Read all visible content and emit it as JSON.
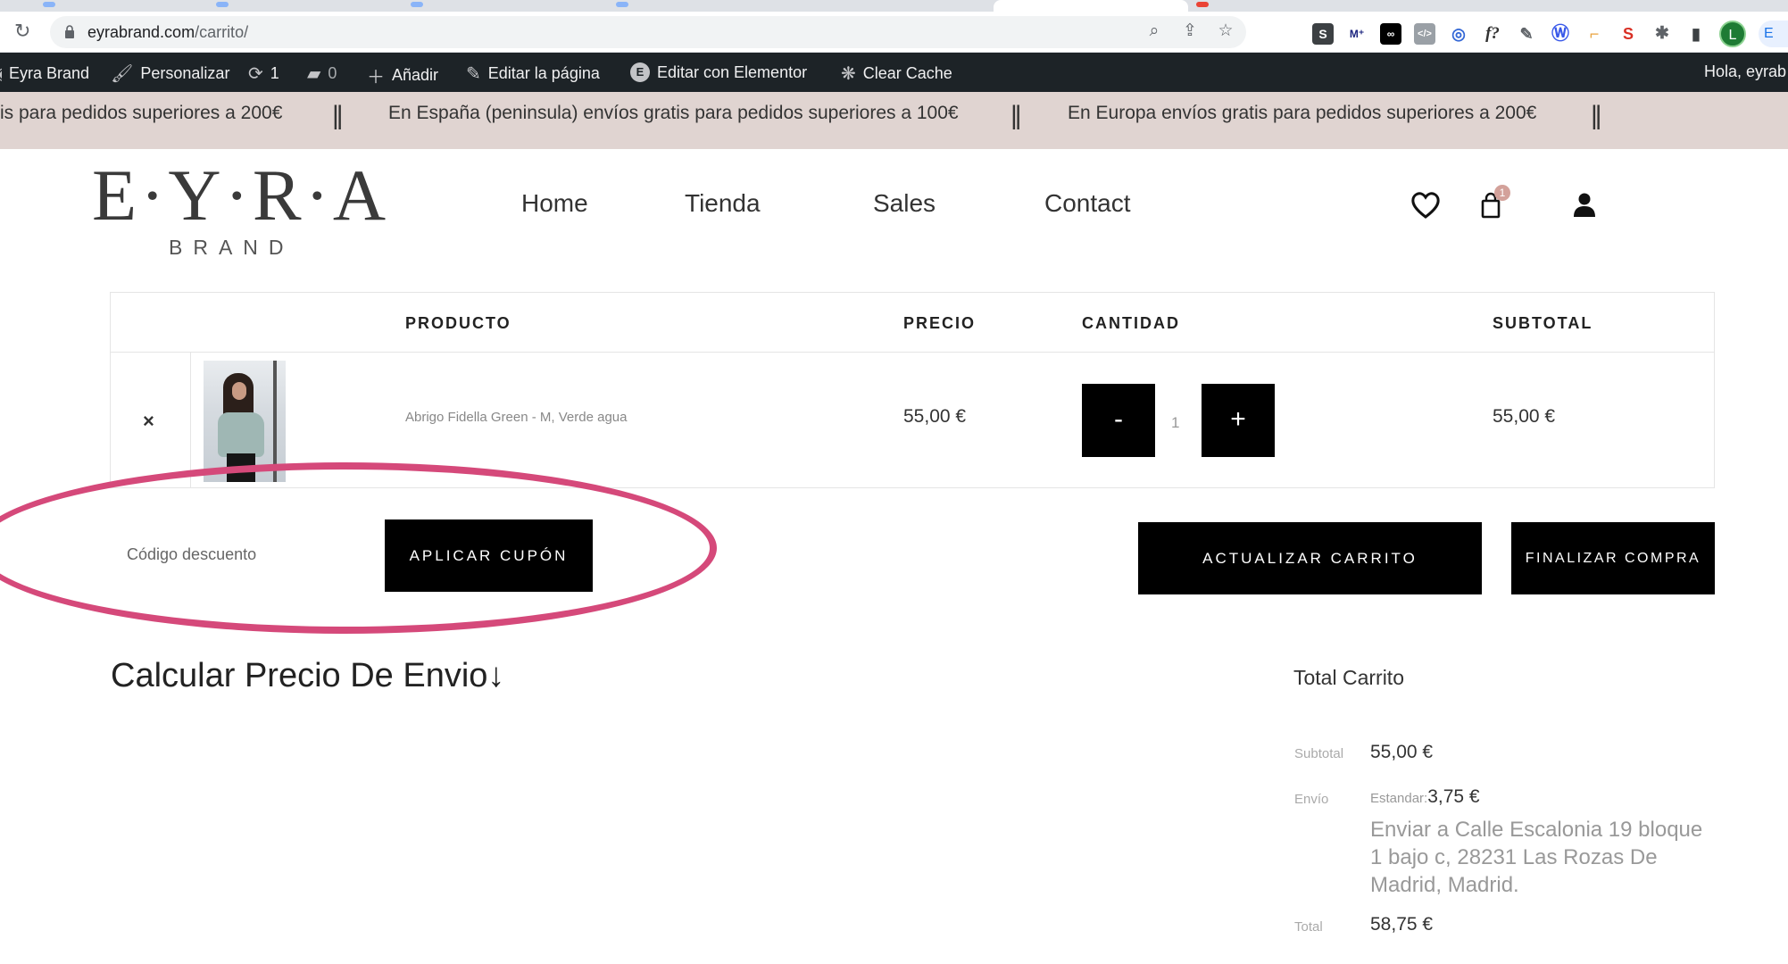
{
  "browser": {
    "url_host": "eyrabrand.com",
    "url_path": "/carrito/",
    "profile_initial": "L",
    "profile_pill": "E"
  },
  "adminbar": {
    "site_name": "Eyra Brand",
    "customize": "Personalizar",
    "updates_count": "1",
    "comments_count": "0",
    "new": "Añadir",
    "edit_page": "Editar la página",
    "elementor": "Editar con Elementor",
    "clear_cache": "Clear Cache",
    "greeting": "Hola, eyrab"
  },
  "announcements": [
    "is para pedidos superiores a 200€",
    "En España (peninsula) envíos gratis para pedidos superiores a 100€",
    "En Europa envíos gratis para pedidos superiores a 200€"
  ],
  "brand": {
    "logo": "E·Y·R·A",
    "sub": "BRAND"
  },
  "nav": [
    "Home",
    "Tienda",
    "Sales",
    "Contact"
  ],
  "header": {
    "cart_count": "1"
  },
  "cart": {
    "columns": {
      "product": "PRODUCTO",
      "price": "PRECIO",
      "quantity": "CANTIDAD",
      "subtotal": "SUBTOTAL"
    },
    "item": {
      "remove": "×",
      "name": "Abrigo Fidella Green - M, Verde agua",
      "price": "55,00 €",
      "qty": "1",
      "minus": "-",
      "plus": "+",
      "subtotal": "55,00 €"
    }
  },
  "actions": {
    "coupon_placeholder": "Código descuento",
    "apply_coupon": "APLICAR CUPÓN",
    "update_cart": "ACTUALIZAR CARRITO",
    "checkout": "FINALIZAR COMPRA"
  },
  "shipping": {
    "title": "Calcular Precio De Envio↓"
  },
  "totals": {
    "title": "Total Carrito",
    "subtotal_label": "Subtotal",
    "subtotal_value": "55,00 €",
    "shipping_label": "Envío",
    "shipping_method": "Estandar:",
    "shipping_value": "3,75 €",
    "shipping_address": "Enviar a Calle Escalonia 19 bloque 1 bajo c, 28231 Las Rozas De Madrid, Madrid.",
    "total_label": "Total",
    "total_value": "58,75 €"
  },
  "colors": {
    "annotation": "#d5497a",
    "announce_bg": "#e0d4d1",
    "adminbar_bg": "#1d2327"
  }
}
